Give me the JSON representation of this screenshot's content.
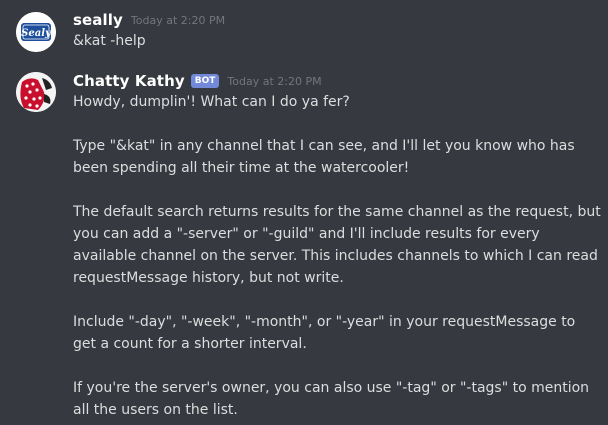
{
  "messages": [
    {
      "username": "seally",
      "timestamp": "Today at 2:20 PM",
      "avatar_icon": "sealy-logo",
      "avatar_text": "Sealy",
      "content": "&kat -help"
    },
    {
      "username": "Chatty Kathy",
      "badge": "BOT",
      "timestamp": "Today at 2:20 PM",
      "avatar_icon": "polka-dot-dress-avatar",
      "lines": [
        "Howdy, dumplin'! What can I do ya fer?",
        "",
        "Type \"&kat\" in any channel that I can see, and I'll let you know who has",
        "been spending all their time at the watercooler!",
        "",
        "The default search returns results for the same channel as the request, but",
        "you can add a \"-server\" or \"-guild\" and I'll include results for every",
        "available channel on the server. This includes channels to which I can read",
        "requestMessage history, but not write.",
        "",
        "Include \"-day\", \"-week\", \"-month\", or \"-year\" in your requestMessage to",
        "get a count for a shorter interval.",
        "",
        "If you're the server's owner, you can also use \"-tag\" or \"-tags\" to mention",
        "all the users on the list."
      ]
    }
  ],
  "colors": {
    "background": "#36393f",
    "text": "#dcddde",
    "username": "#ffffff",
    "timestamp": "#72767d",
    "bot_badge": "#7289da",
    "sealy_blue": "#1d4f9c",
    "kathy_red": "#c8102e"
  }
}
